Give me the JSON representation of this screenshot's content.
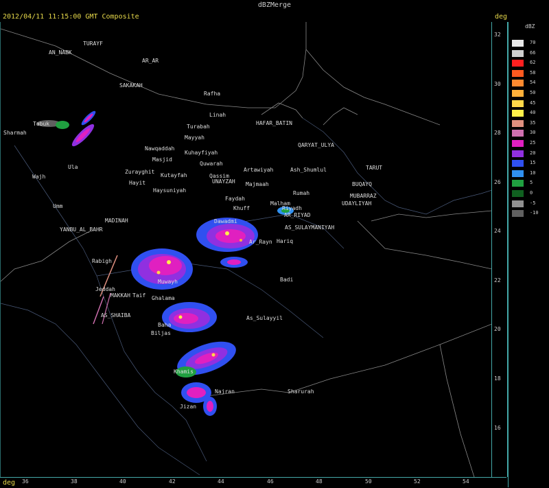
{
  "window_title": "dBZMerge",
  "subtitle": "2012/04/11 11:15:00 GMT Composite",
  "axis_unit_right": "deg",
  "axis_unit_bottom": "deg",
  "lat_ticks": [
    "32",
    "30",
    "28",
    "26",
    "24",
    "22",
    "20",
    "18",
    "16"
  ],
  "lon_ticks": [
    "36",
    "38",
    "40",
    "42",
    "44",
    "46",
    "48",
    "50",
    "52",
    "54"
  ],
  "legend": {
    "title": "dBZ",
    "entries": [
      {
        "label": "70",
        "color": "#e8e8e8"
      },
      {
        "label": "66",
        "color": "#cfcfcf"
      },
      {
        "label": "62",
        "color": "#ff2020"
      },
      {
        "label": "58",
        "color": "#ff5a20"
      },
      {
        "label": "54",
        "color": "#ff8a30"
      },
      {
        "label": "50",
        "color": "#ffb03a"
      },
      {
        "label": "45",
        "color": "#ffd84a"
      },
      {
        "label": "40",
        "color": "#fff04a"
      },
      {
        "label": "35",
        "color": "#e09080"
      },
      {
        "label": "30",
        "color": "#d070b0"
      },
      {
        "label": "25",
        "color": "#e020c0"
      },
      {
        "label": "20",
        "color": "#9030e0"
      },
      {
        "label": "15",
        "color": "#3050f0"
      },
      {
        "label": "10",
        "color": "#3090f0"
      },
      {
        "label": "5",
        "color": "#20a040"
      },
      {
        "label": "0",
        "color": "#106020"
      },
      {
        "label": "-5",
        "color": "#909090"
      },
      {
        "label": "-10",
        "color": "#606060"
      }
    ]
  },
  "cities": [
    {
      "name": "TURAYF"
    },
    {
      "name": "AN_NABK"
    },
    {
      "name": "AR_AR"
    },
    {
      "name": "SAKAKAH"
    },
    {
      "name": "Rafha"
    },
    {
      "name": "Linah"
    },
    {
      "name": "HAFAR_BATIN"
    },
    {
      "name": "Turabah"
    },
    {
      "name": "Mayyah"
    },
    {
      "name": "QARYAT_ULYA"
    },
    {
      "name": "Sharmah"
    },
    {
      "name": "Tabuk"
    },
    {
      "name": "Nawqaddah"
    },
    {
      "name": "Kuhayfiyah"
    },
    {
      "name": "Masjid"
    },
    {
      "name": "Quwarah"
    },
    {
      "name": "Artawiyah"
    },
    {
      "name": "Ash_Shumlul"
    },
    {
      "name": "TARUT"
    },
    {
      "name": "Ula"
    },
    {
      "name": "Zurayghit"
    },
    {
      "name": "Kutayfah"
    },
    {
      "name": "Qassim"
    },
    {
      "name": "UNAYZAH"
    },
    {
      "name": "Majmaah"
    },
    {
      "name": "BUQAYQ"
    },
    {
      "name": "Wajh"
    },
    {
      "name": "Hayit"
    },
    {
      "name": "Haysuniyah"
    },
    {
      "name": "Rumah"
    },
    {
      "name": "MUBARRAZ"
    },
    {
      "name": "UDAYLIYAH"
    },
    {
      "name": "Faydah"
    },
    {
      "name": "Malham"
    },
    {
      "name": "Riyadh"
    },
    {
      "name": "Umm"
    },
    {
      "name": "Khuff"
    },
    {
      "name": "AR_RIYAD"
    },
    {
      "name": "MADINAH"
    },
    {
      "name": "Dawadmi"
    },
    {
      "name": "YANBU_AL_BAHR"
    },
    {
      "name": "AS_SULAYMANIYAH"
    },
    {
      "name": "Ar_Rayn"
    },
    {
      "name": "Hariq"
    },
    {
      "name": "Rabigh"
    },
    {
      "name": "Badi"
    },
    {
      "name": "Muwayh"
    },
    {
      "name": "Jeddah"
    },
    {
      "name": "MAKKAH"
    },
    {
      "name": "Taif"
    },
    {
      "name": "Ghalama"
    },
    {
      "name": "AS_SHAIBA"
    },
    {
      "name": "Baha"
    },
    {
      "name": "As_Sulayyil"
    },
    {
      "name": "Biljas"
    },
    {
      "name": "Khamis"
    },
    {
      "name": "Najran"
    },
    {
      "name": "Sharurah"
    },
    {
      "name": "Jizan"
    }
  ]
}
